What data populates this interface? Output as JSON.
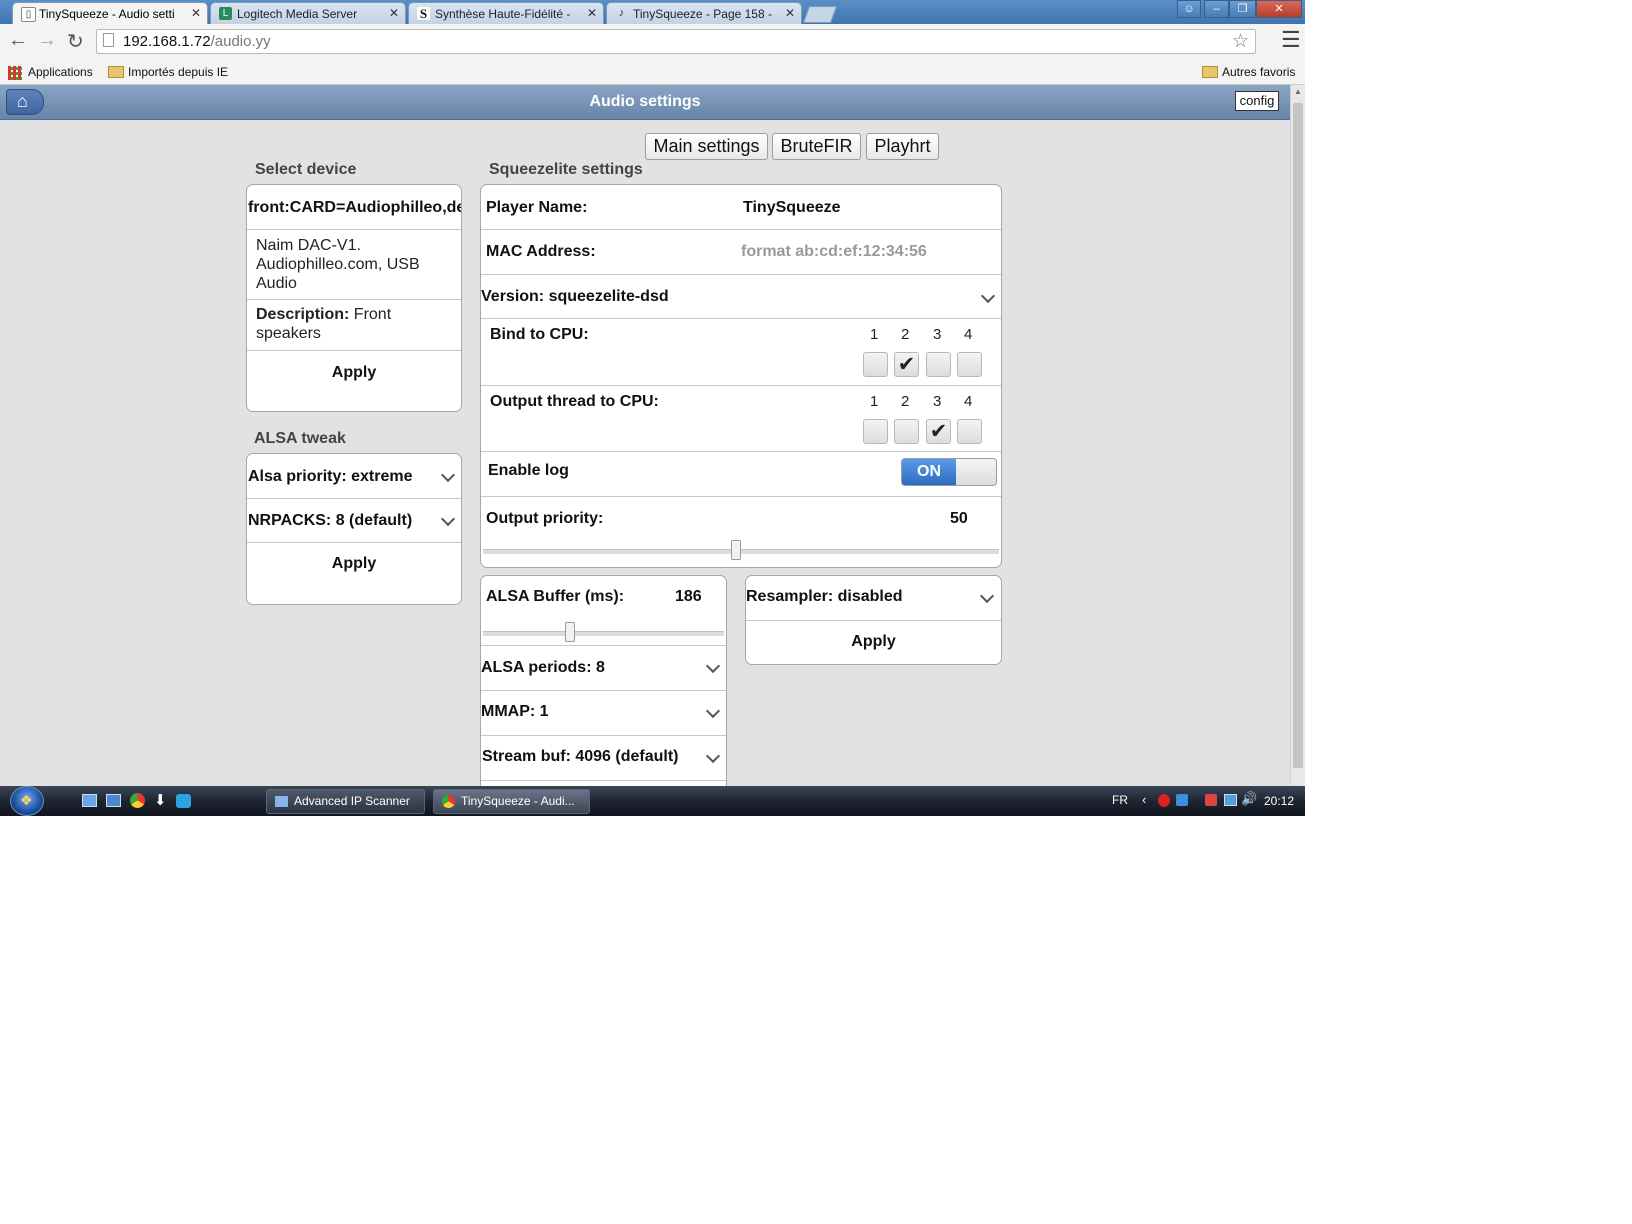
{
  "browser": {
    "tabs": [
      {
        "title": "TinySqueeze - Audio setti",
        "active": true
      },
      {
        "title": "Logitech Media Server",
        "active": false
      },
      {
        "title": "Synthèse Haute-Fidélité -",
        "active": false
      },
      {
        "title": "TinySqueeze - Page 158 -",
        "active": false
      }
    ],
    "url_host": "192.168.1.72",
    "url_path": "/audio.yy",
    "bookmarks": {
      "apps": "Applications",
      "folder": "Importés depuis IE",
      "other": "Autres favoris"
    }
  },
  "header": {
    "title": "Audio settings",
    "config_label": "config"
  },
  "top_tabs": [
    "Main settings",
    "BruteFIR",
    "Playhrt"
  ],
  "select_device": {
    "heading": "Select device",
    "device_value": "front:CARD=Audiophilleo,de",
    "device_name": "Naim DAC-V1. Audiophilleo.com, USB Audio",
    "description_label": "Description:",
    "description_value": "Front speakers",
    "apply": "Apply"
  },
  "alsa_tweak": {
    "heading": "ALSA tweak",
    "priority": "Alsa priority: extreme",
    "nrpacks": "NRPACKS: 8 (default)",
    "apply": "Apply"
  },
  "squeezelite": {
    "heading": "Squeezelite settings",
    "player_name_label": "Player Name:",
    "player_name_value": "TinySqueeze",
    "mac_label": "MAC Address:",
    "mac_placeholder": "format ab:cd:ef:12:34:56",
    "version": "Version: squeezelite-dsd",
    "bind_cpu_label": "Bind to CPU:",
    "output_thread_label": "Output thread to CPU:",
    "cpu_numbers": [
      "1",
      "2",
      "3",
      "4"
    ],
    "bind_cpu_checked": [
      false,
      true,
      false,
      false
    ],
    "output_thread_checked": [
      false,
      false,
      true,
      false
    ],
    "check_glyph": "✔",
    "enable_log_label": "Enable log",
    "enable_log_state": "ON",
    "output_priority_label": "Output priority:",
    "output_priority_value": "50",
    "alsa_buffer_label": "ALSA Buffer (ms):",
    "alsa_buffer_value": "186",
    "alsa_periods": "ALSA periods: 8",
    "mmap": "MMAP: 1",
    "stream_buf": "Stream buf: 4096 (default)",
    "resampler": "Resampler: disabled",
    "resampler_apply": "Apply"
  },
  "taskbar": {
    "apps": [
      "Advanced IP Scanner",
      "TinySqueeze - Audi..."
    ],
    "lang": "FR",
    "clock": "20:12"
  },
  "colors": {
    "accent": "#3a78d4",
    "header": "#7892b6"
  }
}
